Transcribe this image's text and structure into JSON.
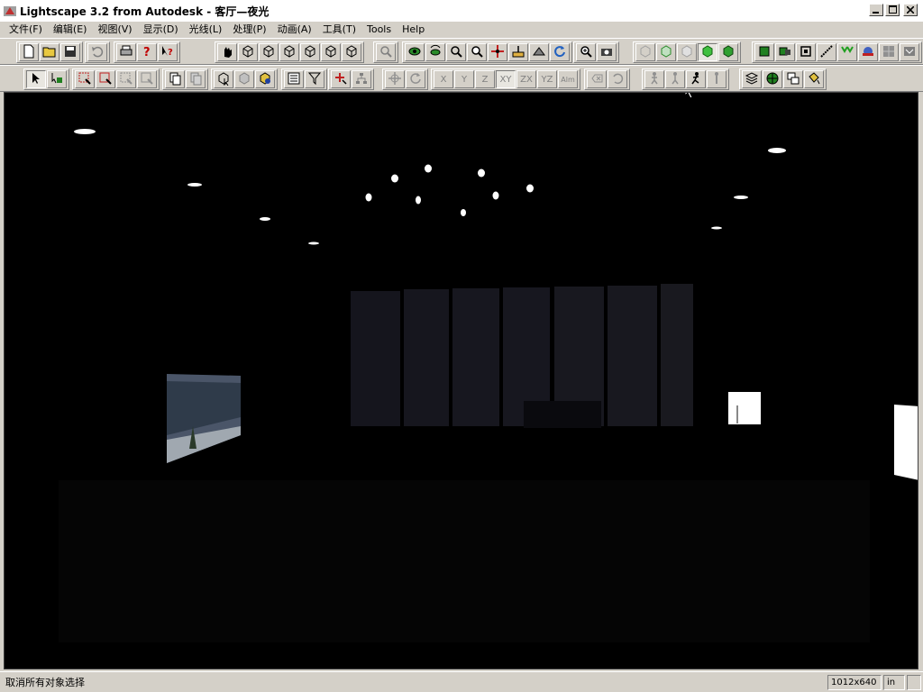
{
  "window": {
    "title": "Lightscape 3.2 from Autodesk - 客厅—夜光"
  },
  "menu": [
    {
      "label": "文件(F)"
    },
    {
      "label": "编辑(E)"
    },
    {
      "label": "视图(V)"
    },
    {
      "label": "显示(D)"
    },
    {
      "label": "光线(L)"
    },
    {
      "label": "处理(P)"
    },
    {
      "label": "动画(A)"
    },
    {
      "label": "工具(T)"
    },
    {
      "label": "Tools"
    },
    {
      "label": "Help"
    }
  ],
  "toolbar2": {
    "axis_labels": [
      "X",
      "Y",
      "Z",
      "XY",
      "ZX",
      "YZ",
      "Alm"
    ]
  },
  "status": {
    "message": "取消所有对象选择",
    "resolution": "1012x640",
    "units": "in"
  },
  "colors": {
    "viewport_bg": "#000000",
    "window_panels": "#1a1a22",
    "light_fixtures": "#ffffff",
    "painting": "#5a6070"
  }
}
